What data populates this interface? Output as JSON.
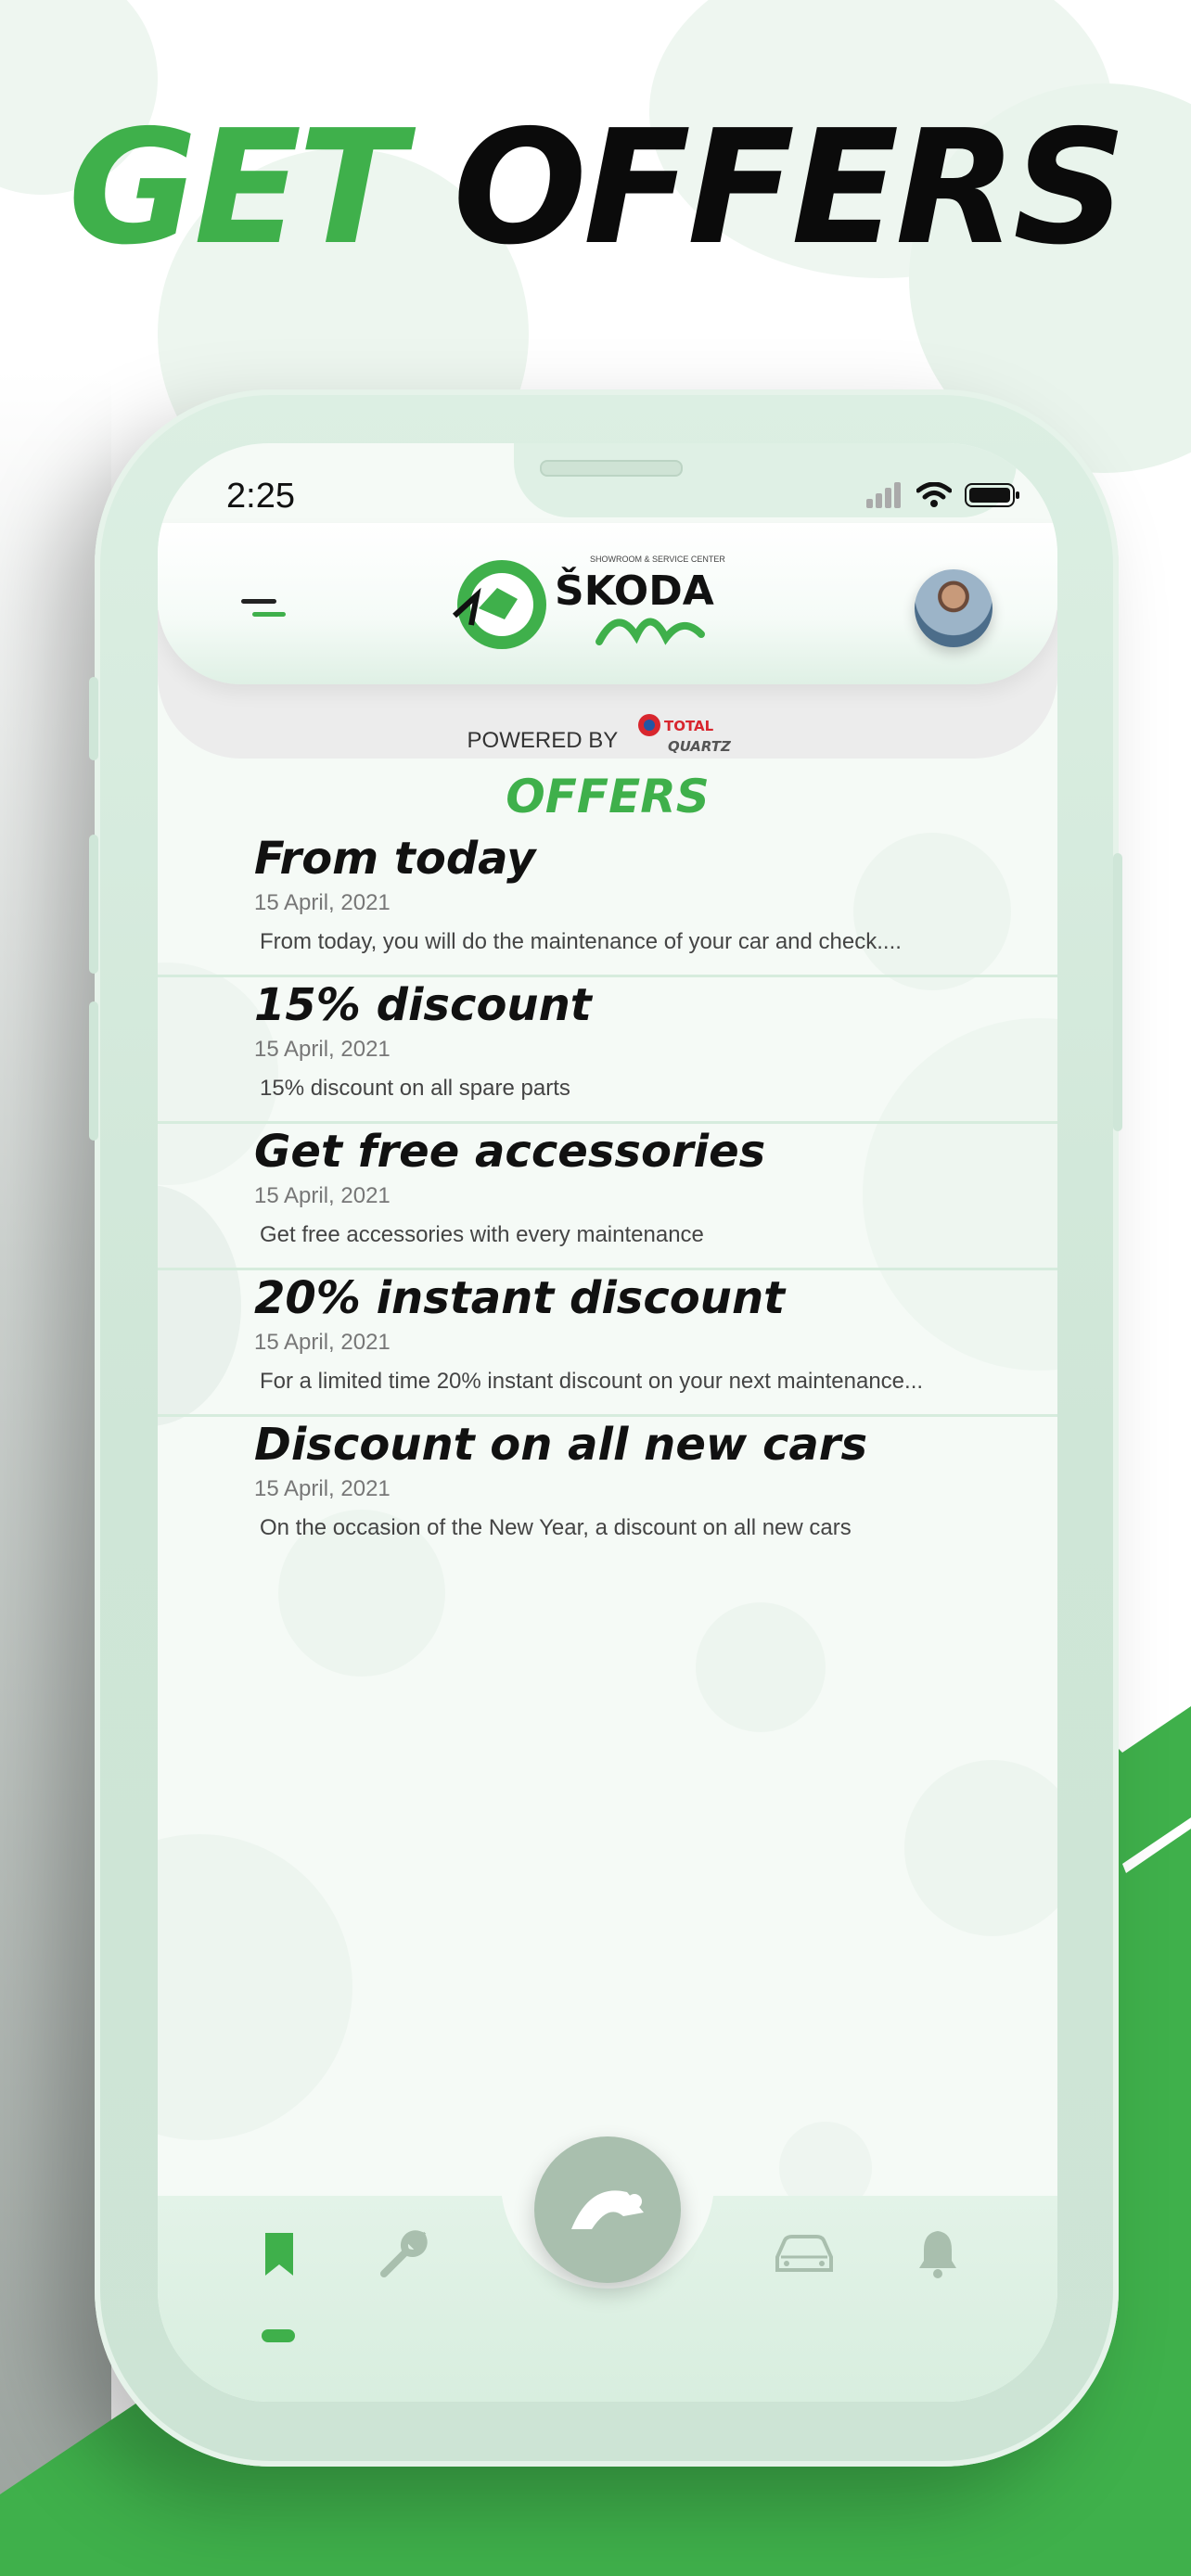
{
  "headline": {
    "part1": "GET",
    "part2": "OFFERS"
  },
  "status_bar": {
    "time": "2:25"
  },
  "header": {
    "logo_text": "ŠKODA",
    "logo_subtext": "SHOWROOM & SERVICE CENTER",
    "powered_by": "POWERED BY",
    "sponsor": "TOTAL QUARTZ"
  },
  "page_title": "OFFERS",
  "offers": [
    {
      "title": "From today",
      "date": "15 April, 2021",
      "desc": "From today, you will do the maintenance of your car and check...."
    },
    {
      "title": "15% discount",
      "date": "15 April, 2021",
      "desc": "15% discount on all spare parts"
    },
    {
      "title": "Get free accessories",
      "date": "15 April, 2021",
      "desc": "Get free accessories with every maintenance"
    },
    {
      "title": "20% instant discount",
      "date": "15 April, 2021",
      "desc": "For a limited time 20% instant discount on your next maintenance..."
    },
    {
      "title": "Discount on all new cars",
      "date": "15 April, 2021",
      "desc": "On the occasion of the New Year, a discount on all new cars"
    }
  ],
  "tabbar": {
    "items": [
      "bookmark-icon",
      "wrench-icon",
      "skoda-logo-icon",
      "car-icon",
      "bell-icon"
    ],
    "active": "bookmark-icon"
  },
  "colors": {
    "accent": "#3fb04b",
    "tint": "#dff0e5",
    "text": "#111111"
  }
}
